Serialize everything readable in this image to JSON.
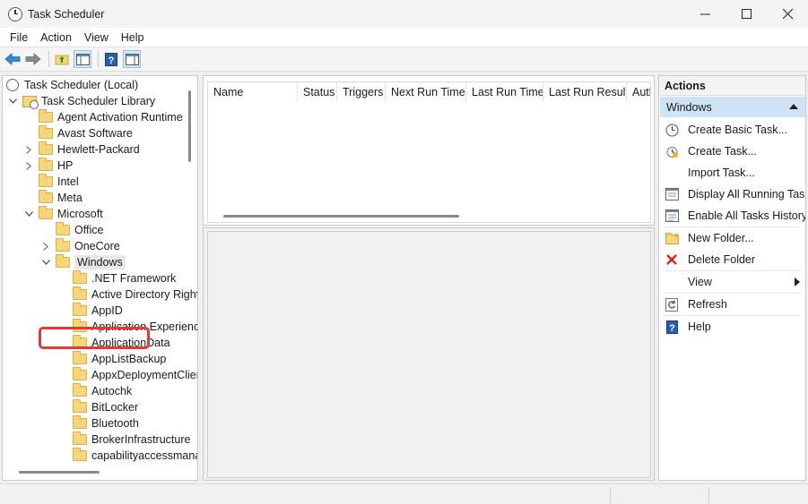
{
  "window": {
    "title": "Task Scheduler"
  },
  "menu": [
    "File",
    "Action",
    "View",
    "Help"
  ],
  "toolbar": {
    "buttons": [
      "back-arrow-icon",
      "forward-arrow-icon",
      "up-folder-icon",
      "show-hide-tree-icon",
      "help-icon",
      "show-hide-action-pane-icon"
    ]
  },
  "tree": {
    "root": "Task Scheduler (Local)",
    "library": "Task Scheduler Library",
    "items": [
      {
        "label": "Agent Activation Runtime",
        "level": 2,
        "expander": ""
      },
      {
        "label": "Avast Software",
        "level": 2,
        "expander": ""
      },
      {
        "label": "Hewlett-Packard",
        "level": 2,
        "expander": "collapsed"
      },
      {
        "label": "HP",
        "level": 2,
        "expander": "collapsed"
      },
      {
        "label": "Intel",
        "level": 2,
        "expander": ""
      },
      {
        "label": "Meta",
        "level": 2,
        "expander": ""
      },
      {
        "label": "Microsoft",
        "level": 2,
        "expander": "expanded"
      },
      {
        "label": "Office",
        "level": 3,
        "expander": ""
      },
      {
        "label": "OneCore",
        "level": 3,
        "expander": "collapsed"
      },
      {
        "label": "Windows",
        "level": 3,
        "expander": "expanded",
        "selected": true
      },
      {
        "label": ".NET Framework",
        "level": 4,
        "expander": ""
      },
      {
        "label": "Active Directory Rights Management Services Client",
        "level": 4,
        "expander": ""
      },
      {
        "label": "AppID",
        "level": 4,
        "expander": ""
      },
      {
        "label": "Application Experience",
        "level": 4,
        "expander": ""
      },
      {
        "label": "ApplicationData",
        "level": 4,
        "expander": ""
      },
      {
        "label": "AppListBackup",
        "level": 4,
        "expander": ""
      },
      {
        "label": "AppxDeploymentClient",
        "level": 4,
        "expander": ""
      },
      {
        "label": "Autochk",
        "level": 4,
        "expander": ""
      },
      {
        "label": "BitLocker",
        "level": 4,
        "expander": ""
      },
      {
        "label": "Bluetooth",
        "level": 4,
        "expander": ""
      },
      {
        "label": "BrokerInfrastructure",
        "level": 4,
        "expander": ""
      },
      {
        "label": "capabilityaccessmanager",
        "level": 4,
        "expander": ""
      }
    ]
  },
  "table": {
    "columns": [
      "Name",
      "Status",
      "Triggers",
      "Next Run Time",
      "Last Run Time",
      "Last Run Result",
      "Author"
    ]
  },
  "actions": {
    "header": "Actions",
    "section": "Windows",
    "items": [
      {
        "label": "Create Basic Task...",
        "icon": "create-basic-task-icon"
      },
      {
        "label": "Create Task...",
        "icon": "create-task-icon"
      },
      {
        "label": "Import Task...",
        "icon": ""
      },
      {
        "label": "Display All Running Tasks",
        "icon": "display-running-tasks-icon"
      },
      {
        "label": "Enable All Tasks History",
        "icon": "enable-history-icon"
      },
      {
        "label": "New Folder...",
        "icon": "new-folder-icon"
      },
      {
        "label": "Delete Folder",
        "icon": "delete-icon"
      },
      {
        "label": "View",
        "icon": "",
        "submenu": true
      },
      {
        "label": "Refresh",
        "icon": "refresh-icon"
      },
      {
        "label": "Help",
        "icon": "help-icon"
      }
    ]
  },
  "colors": {
    "accent": "#cfe3f7",
    "highlight_box": "#e03a3a",
    "folder": "#f5d67b"
  }
}
